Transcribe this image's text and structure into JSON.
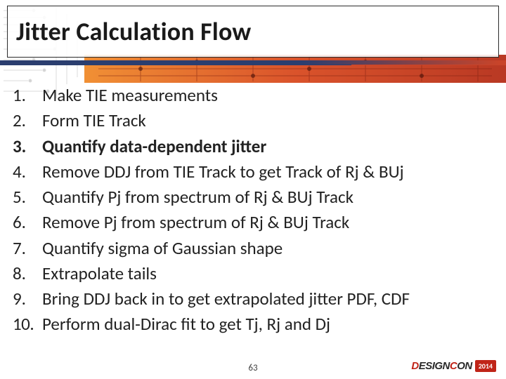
{
  "title": "Jitter Calculation Flow",
  "items": [
    {
      "n": "1.",
      "text": "Make TIE measurements",
      "bold": false
    },
    {
      "n": "2.",
      "text": "Form TIE Track",
      "bold": false
    },
    {
      "n": "3.",
      "text": "Quantify data-dependent jitter",
      "bold": true
    },
    {
      "n": "4.",
      "text": "Remove DDJ from TIE Track to get Track of Rj & BUj",
      "bold": false
    },
    {
      "n": "5.",
      "text": "Quantify Pj from spectrum of Rj & BUj Track",
      "bold": false
    },
    {
      "n": "6.",
      "text": "Remove Pj from spectrum of Rj & BUj Track",
      "bold": false
    },
    {
      "n": "7.",
      "text": "Quantify sigma of Gaussian shape",
      "bold": false
    },
    {
      "n": "8.",
      "text": "Extrapolate tails",
      "bold": false
    },
    {
      "n": "9.",
      "text": "Bring DDJ back in to get extrapolated jitter PDF, CDF",
      "bold": false
    },
    {
      "n": "10.",
      "text": "Perform dual-Dirac fit to get Tj, Rj and Dj",
      "bold": false
    }
  ],
  "page_number": "63",
  "logo": {
    "part1": "D",
    "part2": "ESIGN",
    "part3": "C",
    "part4": "ON",
    "year": "2014"
  }
}
